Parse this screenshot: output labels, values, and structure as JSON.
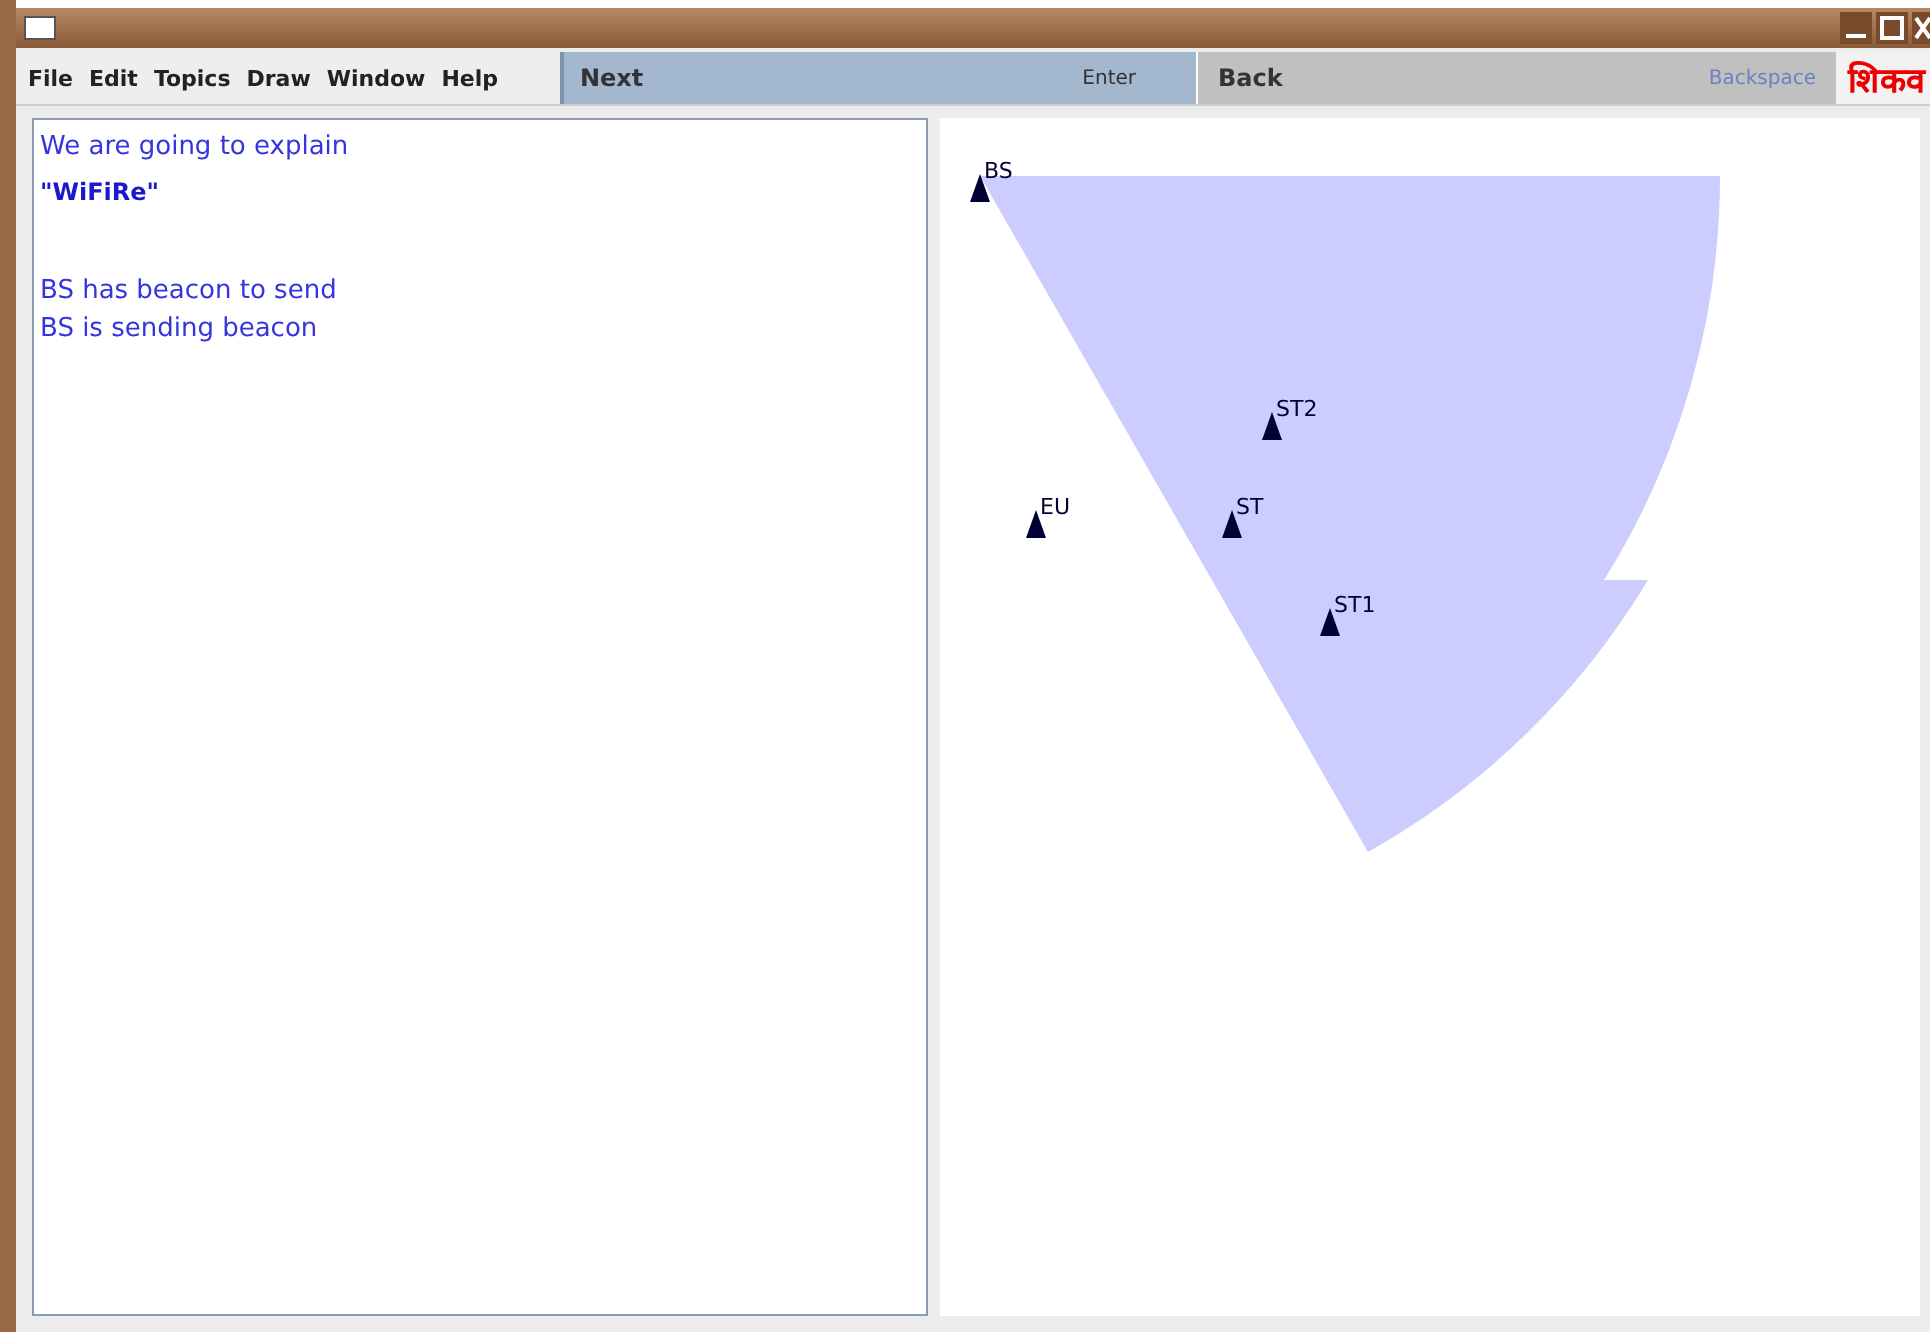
{
  "menu": [
    "File",
    "Edit",
    "Topics",
    "Draw",
    "Window",
    "Help"
  ],
  "next": {
    "label": "Next",
    "shortcut": "Enter"
  },
  "back": {
    "label": "Back",
    "shortcut": "Backspace"
  },
  "brand": "शिकव",
  "lines": [
    {
      "text": "We are going to explain",
      "kind": "plain"
    },
    {
      "text": "\"WiFiRe\"",
      "kind": "bold"
    },
    {
      "kind": "gap"
    },
    {
      "text": "BS has beacon to send",
      "kind": "plain"
    },
    {
      "text": "BS is sending beacon",
      "kind": "plain"
    }
  ],
  "nodes": [
    {
      "label": "BS"
    },
    {
      "label": "ST2"
    },
    {
      "label": "EU"
    },
    {
      "label": "ST"
    },
    {
      "label": "ST1"
    }
  ]
}
